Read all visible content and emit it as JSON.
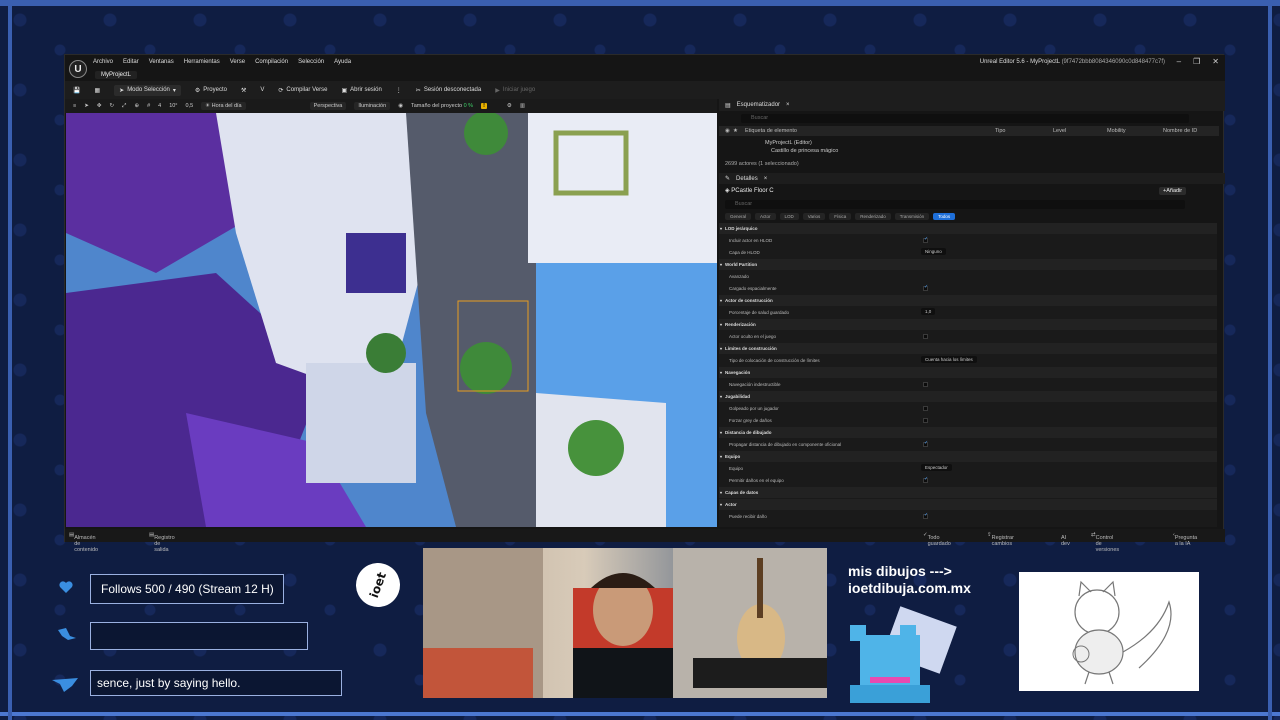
{
  "editor": {
    "menu": [
      "Archivo",
      "Editar",
      "Ventanas",
      "Herramientas",
      "Versе",
      "Compilación",
      "Selección",
      "Ayuda"
    ],
    "project_tab": "MyProjectL",
    "window_title_app": "Unreal Editor 5.6 - MyProjectL",
    "window_title_hash": "(9f7472bbb8084346090c0d848477c7f)",
    "logo": "U",
    "toolbar": {
      "mode": "Modo Selección",
      "project": "Proyecto",
      "compile": "Compilar Verse",
      "open_session": "Abrir sesión",
      "session_status": "Sesión desconectada",
      "start_game": "Iniciar juego"
    },
    "viewport_bar": {
      "snap_values": [
        "4",
        "10°",
        "0,5"
      ],
      "time_of_day": "Hora del día",
      "perspective": "Perspectiva",
      "lighting": "Iluminación",
      "project_size_label": "Tamaño del proyecto",
      "project_size_value": "0 %",
      "warning": "!"
    },
    "outliner": {
      "title": "Esquematizador",
      "search_placeholder": "Buscar",
      "columns": [
        "Etiqueta de elemento",
        "Tipo",
        "Level",
        "Mobility",
        "Nombre de ID"
      ],
      "rows": [
        "MyProjectL (Editor)",
        "Castillo de princesa mágico"
      ],
      "count": "2699 actores (1 seleccionado)"
    },
    "details": {
      "title": "Detalles",
      "actor": "PCastle Floor C",
      "add_label": "Añadir",
      "search_placeholder": "Buscar",
      "tabs": [
        "General",
        "Actor",
        "LOD",
        "Varios",
        "Física",
        "Renderizado",
        "Transmisión",
        "Todos"
      ],
      "active_tab": "Todos",
      "rows": [
        {
          "type": "cat",
          "label": "LOD jerárquico"
        },
        {
          "type": "chk",
          "label": "Incluir actor en HLOD",
          "on": true
        },
        {
          "type": "val",
          "label": "Capa de HLOD",
          "value": "Ninguno"
        },
        {
          "type": "cat",
          "label": "World Partition"
        },
        {
          "type": "plain",
          "label": "Avanzado"
        },
        {
          "type": "chk",
          "label": "Cargado espacialmente",
          "on": true
        },
        {
          "type": "cat",
          "label": "Actor de construcción"
        },
        {
          "type": "val",
          "label": "Porcentaje de salud guardado",
          "value": "1,0"
        },
        {
          "type": "cat",
          "label": "Renderización"
        },
        {
          "type": "chk",
          "label": "Actor oculto en el juego",
          "on": false
        },
        {
          "type": "cat",
          "label": "Límites de construcción"
        },
        {
          "type": "val",
          "label": "Tipo de colocación de construcción de límites",
          "value": "Cuenta hacia los límites"
        },
        {
          "type": "cat",
          "label": "Navegación"
        },
        {
          "type": "chk",
          "label": "Navegación indestructible",
          "on": false
        },
        {
          "type": "cat",
          "label": "Jugabilidad"
        },
        {
          "type": "chk",
          "label": "Golpeado por un jugador",
          "on": false
        },
        {
          "type": "chk",
          "label": "Forzar grey de daños",
          "on": false
        },
        {
          "type": "cat",
          "label": "Distancia de dibujado"
        },
        {
          "type": "chk",
          "label": "Propagar distancia de dibujado en componente oficional",
          "on": true
        },
        {
          "type": "cat",
          "label": "Equipo"
        },
        {
          "type": "val",
          "label": "Equipo",
          "value": "Espectador"
        },
        {
          "type": "chk",
          "label": "Permitir daños en el equipo",
          "on": true
        },
        {
          "type": "cat",
          "label": "Capas de datos"
        },
        {
          "type": "cat",
          "label": "Actor"
        },
        {
          "type": "chk",
          "label": "Puede recibir daño",
          "on": true
        }
      ]
    },
    "status": {
      "content_drawer": "Almacén de contenido",
      "output_log": "Registro de salida",
      "saved": "Todo guardado",
      "register": "Registrar cambios",
      "ai": "AI dev",
      "version_control": "Control de versiones",
      "ask_ai": "Pregunta a la IA"
    }
  },
  "overlay": {
    "follows": "Follows 500 / 490 (Stream 12 H)",
    "chat_text": "sence, just by saying hello.",
    "ioet_logo": "ioet",
    "drawings_line1": "mis dibujos --->",
    "drawings_line2": "ioetdibuja.com.mx"
  },
  "colors": {
    "accent_blue": "#1e6fd9",
    "overlay_border": "#9ab0e0",
    "background": "#0f1d42",
    "warning": "#e8b000"
  }
}
